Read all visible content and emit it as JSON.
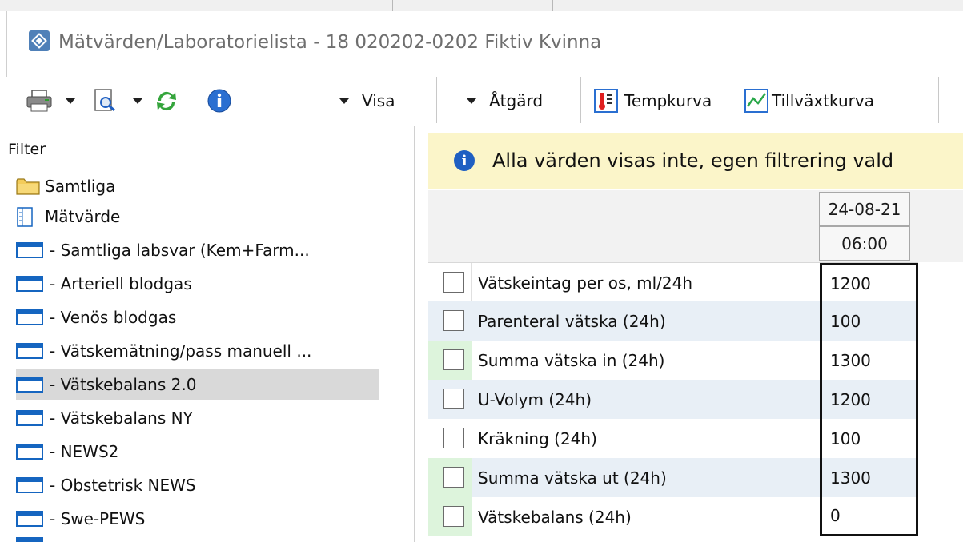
{
  "window": {
    "title": "Mätvärden/Laboratorielista - 18 020202-0202 Fiktiv Kvinna"
  },
  "toolbar": {
    "print_icon": "printer-icon",
    "preview_icon": "print-preview-icon",
    "refresh_icon": "refresh-icon",
    "info_icon": "info-icon",
    "visa_label": "Visa",
    "atgard_label": "Åtgärd",
    "tempkurva_label": "Tempkurva",
    "tillvaxtkurva_label": "Tillväxtkurva"
  },
  "filter": {
    "header": "Filter",
    "items": [
      {
        "label": "Samtliga",
        "icon": "folder-icon"
      },
      {
        "label": "Mätvärde",
        "icon": "list-icon"
      },
      {
        "label": "- Samtliga labsvar (Kem+Farm...",
        "icon": "window-icon"
      },
      {
        "label": "- Arteriell blodgas",
        "icon": "window-icon"
      },
      {
        "label": "- Venös blodgas",
        "icon": "window-icon"
      },
      {
        "label": "- Vätskemätning/pass manuell ...",
        "icon": "window-icon"
      },
      {
        "label": "- Vätskebalans 2.0",
        "icon": "window-icon",
        "selected": true
      },
      {
        "label": "- Vätskebalans NY",
        "icon": "window-icon"
      },
      {
        "label": "- NEWS2",
        "icon": "window-icon"
      },
      {
        "label": "- Obstetrisk NEWS",
        "icon": "window-icon"
      },
      {
        "label": "- Swe-PEWS",
        "icon": "window-icon"
      }
    ]
  },
  "info": {
    "message": "Alla värden visas inte, egen filtrering vald"
  },
  "grid": {
    "date": "24-08-21",
    "time": "06:00",
    "rows": [
      {
        "label": "Vätskeintag per os, ml/24h",
        "value": "1200"
      },
      {
        "label": "Parenteral vätska (24h)",
        "value": "100"
      },
      {
        "label": "Summa vätska in (24h)",
        "value": "1300"
      },
      {
        "label": "U-Volym (24h)",
        "value": "1200"
      },
      {
        "label": "Kräkning (24h)",
        "value": "100"
      },
      {
        "label": "Summa vätska ut (24h)",
        "value": "1300"
      },
      {
        "label": "Vätskebalans (24h)",
        "value": "0"
      }
    ]
  },
  "colors": {
    "accent": "#1565c0",
    "info_bg": "#fbf5c9",
    "row_alt": "#e8eff6",
    "selected": "#d9d9d9",
    "sum_green": "#ddf4dc"
  }
}
